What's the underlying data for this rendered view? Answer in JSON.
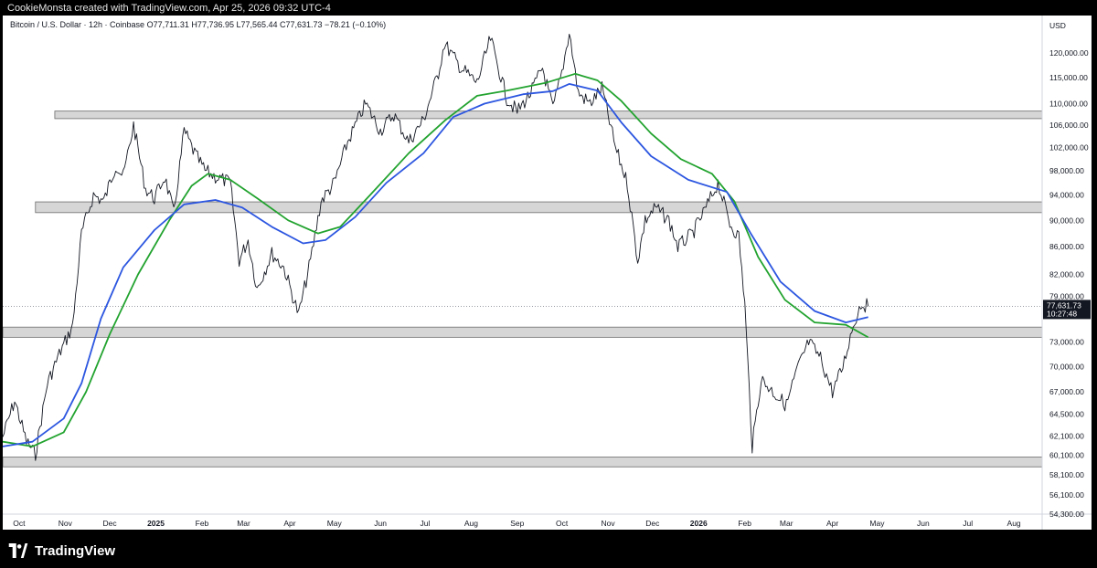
{
  "header": {
    "text": "CookieMonsta created with TradingView.com, Apr 25, 2026 09:32 UTC-4"
  },
  "footer": {
    "brand": "TradingView"
  },
  "chart_data": {
    "type": "line",
    "symbol_line": "Bitcoin / U.S. Dollar · 12h · Coinbase  O77,711.31  H77,736.95  L77,565.44  C77,631.73  −78.21 (−0.10%)",
    "currency": "USD",
    "y_scale": "log",
    "ylim": [
      54300,
      128000
    ],
    "y_ticks": [
      "120,000.00",
      "115,000.00",
      "110,000.00",
      "106,000.00",
      "102,000.00",
      "98,000.00",
      "94,000.00",
      "90,000.00",
      "86,000.00",
      "82,000.00",
      "79,000.00",
      "73,000.00",
      "70,000.00",
      "67,000.00",
      "64,500.00",
      "62,100.00",
      "60,100.00",
      "58,100.00",
      "56,100.00",
      "54,300.00"
    ],
    "x_ticks": [
      {
        "label": "Oct",
        "date": "2024-10-01"
      },
      {
        "label": "Nov",
        "date": "2024-11-01"
      },
      {
        "label": "Dec",
        "date": "2024-12-01"
      },
      {
        "label": "2025",
        "date": "2025-01-01"
      },
      {
        "label": "Feb",
        "date": "2025-02-01"
      },
      {
        "label": "Mar",
        "date": "2025-03-01"
      },
      {
        "label": "Apr",
        "date": "2025-04-01"
      },
      {
        "label": "May",
        "date": "2025-05-01"
      },
      {
        "label": "Jun",
        "date": "2025-06-01"
      },
      {
        "label": "Jul",
        "date": "2025-07-01"
      },
      {
        "label": "Aug",
        "date": "2025-08-01"
      },
      {
        "label": "Sep",
        "date": "2025-09-01"
      },
      {
        "label": "Oct",
        "date": "2025-10-01"
      },
      {
        "label": "Nov",
        "date": "2025-11-01"
      },
      {
        "label": "Dec",
        "date": "2025-12-01"
      },
      {
        "label": "2026",
        "date": "2026-01-01"
      },
      {
        "label": "Feb",
        "date": "2026-02-01"
      },
      {
        "label": "Mar",
        "date": "2026-03-01"
      },
      {
        "label": "Apr",
        "date": "2026-04-01"
      },
      {
        "label": "May",
        "date": "2026-05-01"
      },
      {
        "label": "Jun",
        "date": "2026-06-01"
      },
      {
        "label": "Jul",
        "date": "2026-07-01"
      },
      {
        "label": "Aug",
        "date": "2026-08-01"
      }
    ],
    "xlim": [
      "2024-09-20",
      "2026-08-20"
    ],
    "last_price": {
      "label": "77,631.73",
      "value": 77631.73,
      "countdown": "10:27:48",
      "color": "#131722"
    },
    "zones": [
      {
        "name": "resistance-zone-108k",
        "low": 107200,
        "high": 108600,
        "date_start": "2024-10-25"
      },
      {
        "name": "resistance-zone-92k",
        "low": 91200,
        "high": 92900,
        "date_start": "2024-10-12"
      },
      {
        "name": "support-zone-74k",
        "low": 73600,
        "high": 74900,
        "date_start": "2024-09-20"
      },
      {
        "name": "support-zone-59k",
        "low": 58900,
        "high": 59900,
        "date_start": "2024-09-20"
      }
    ],
    "series": [
      {
        "color": "#131722",
        "style": "price",
        "points": [
          [
            "2024-09-20",
            62000
          ],
          [
            "2024-09-28",
            66000
          ],
          [
            "2024-10-06",
            61500
          ],
          [
            "2024-10-12",
            60200
          ],
          [
            "2024-10-20",
            68000
          ],
          [
            "2024-10-28",
            71500
          ],
          [
            "2024-11-06",
            75000
          ],
          [
            "2024-11-12",
            88000
          ],
          [
            "2024-11-20",
            94000
          ],
          [
            "2024-11-27",
            93000
          ],
          [
            "2024-12-05",
            99000
          ],
          [
            "2024-12-10",
            97000
          ],
          [
            "2024-12-17",
            106000
          ],
          [
            "2024-12-25",
            95000
          ],
          [
            "2024-12-31",
            93500
          ],
          [
            "2025-01-07",
            97000
          ],
          [
            "2025-01-13",
            91000
          ],
          [
            "2025-01-20",
            105000
          ],
          [
            "2025-01-27",
            101000
          ],
          [
            "2025-02-03",
            98000
          ],
          [
            "2025-02-10",
            97000
          ],
          [
            "2025-02-20",
            96000
          ],
          [
            "2025-02-26",
            84000
          ],
          [
            "2025-03-04",
            87000
          ],
          [
            "2025-03-10",
            80000
          ],
          [
            "2025-03-20",
            85000
          ],
          [
            "2025-03-28",
            83000
          ],
          [
            "2025-04-07",
            76500
          ],
          [
            "2025-04-15",
            84000
          ],
          [
            "2025-04-22",
            93000
          ],
          [
            "2025-05-01",
            96000
          ],
          [
            "2025-05-10",
            103000
          ],
          [
            "2025-05-22",
            110000
          ],
          [
            "2025-06-01",
            105000
          ],
          [
            "2025-06-10",
            108000
          ],
          [
            "2025-06-20",
            103000
          ],
          [
            "2025-06-30",
            107000
          ],
          [
            "2025-07-10",
            116000
          ],
          [
            "2025-07-14",
            122000
          ],
          [
            "2025-07-25",
            117000
          ],
          [
            "2025-08-05",
            114000
          ],
          [
            "2025-08-14",
            123000
          ],
          [
            "2025-08-25",
            111000
          ],
          [
            "2025-09-01",
            108500
          ],
          [
            "2025-09-10",
            112000
          ],
          [
            "2025-09-18",
            117000
          ],
          [
            "2025-09-25",
            109000
          ],
          [
            "2025-10-01",
            116000
          ],
          [
            "2025-10-06",
            124500
          ],
          [
            "2025-10-12",
            112000
          ],
          [
            "2025-10-20",
            110000
          ],
          [
            "2025-10-28",
            113000
          ],
          [
            "2025-11-06",
            102000
          ],
          [
            "2025-11-14",
            96000
          ],
          [
            "2025-11-21",
            84000
          ],
          [
            "2025-11-26",
            90000
          ],
          [
            "2025-12-03",
            92000
          ],
          [
            "2025-12-12",
            90000
          ],
          [
            "2025-12-18",
            86000
          ],
          [
            "2025-12-28",
            88000
          ],
          [
            "2026-01-05",
            91500
          ],
          [
            "2026-01-14",
            96000
          ],
          [
            "2026-01-22",
            89500
          ],
          [
            "2026-01-28",
            87500
          ],
          [
            "2026-02-01",
            78000
          ],
          [
            "2026-02-06",
            61000
          ],
          [
            "2026-02-12",
            68500
          ],
          [
            "2026-02-20",
            67000
          ],
          [
            "2026-03-01",
            65500
          ],
          [
            "2026-03-08",
            69500
          ],
          [
            "2026-03-16",
            73000
          ],
          [
            "2026-03-24",
            71000
          ],
          [
            "2026-04-01",
            67000
          ],
          [
            "2026-04-08",
            70000
          ],
          [
            "2026-04-14",
            74500
          ],
          [
            "2026-04-20",
            78000
          ],
          [
            "2026-04-25",
            77631.73
          ]
        ]
      },
      {
        "color": "#22a32f",
        "style": "ma",
        "points": [
          [
            "2024-09-20",
            61500
          ],
          [
            "2024-10-10",
            61000
          ],
          [
            "2024-10-31",
            62500
          ],
          [
            "2024-11-15",
            67000
          ],
          [
            "2024-12-01",
            74000
          ],
          [
            "2024-12-20",
            82000
          ],
          [
            "2025-01-10",
            90000
          ],
          [
            "2025-01-25",
            95500
          ],
          [
            "2025-02-05",
            97500
          ],
          [
            "2025-02-20",
            96500
          ],
          [
            "2025-03-10",
            93500
          ],
          [
            "2025-03-31",
            90000
          ],
          [
            "2025-04-20",
            88000
          ],
          [
            "2025-05-05",
            89000
          ],
          [
            "2025-05-25",
            94000
          ],
          [
            "2025-06-20",
            101000
          ],
          [
            "2025-07-15",
            107000
          ],
          [
            "2025-08-05",
            111500
          ],
          [
            "2025-08-25",
            112500
          ],
          [
            "2025-09-20",
            114000
          ],
          [
            "2025-10-10",
            115800
          ],
          [
            "2025-10-25",
            114500
          ],
          [
            "2025-11-10",
            110500
          ],
          [
            "2025-11-30",
            104500
          ],
          [
            "2025-12-20",
            100000
          ],
          [
            "2026-01-10",
            97500
          ],
          [
            "2026-01-25",
            93000
          ],
          [
            "2026-02-10",
            84500
          ],
          [
            "2026-02-28",
            78500
          ],
          [
            "2026-03-20",
            75500
          ],
          [
            "2026-04-10",
            75200
          ],
          [
            "2026-04-25",
            73600
          ]
        ]
      },
      {
        "color": "#2c56e0",
        "style": "ma",
        "points": [
          [
            "2024-09-20",
            61000
          ],
          [
            "2024-10-10",
            61500
          ],
          [
            "2024-10-31",
            64000
          ],
          [
            "2024-11-12",
            68000
          ],
          [
            "2024-11-25",
            76000
          ],
          [
            "2024-12-10",
            83000
          ],
          [
            "2024-12-31",
            88500
          ],
          [
            "2025-01-20",
            92500
          ],
          [
            "2025-02-10",
            93200
          ],
          [
            "2025-02-28",
            92000
          ],
          [
            "2025-03-20",
            89000
          ],
          [
            "2025-04-10",
            86500
          ],
          [
            "2025-04-25",
            87000
          ],
          [
            "2025-05-15",
            90500
          ],
          [
            "2025-06-05",
            96000
          ],
          [
            "2025-06-30",
            101000
          ],
          [
            "2025-07-20",
            107500
          ],
          [
            "2025-08-10",
            110000
          ],
          [
            "2025-09-05",
            111800
          ],
          [
            "2025-09-25",
            112400
          ],
          [
            "2025-10-06",
            113800
          ],
          [
            "2025-10-25",
            112500
          ],
          [
            "2025-11-10",
            106500
          ],
          [
            "2025-11-30",
            100500
          ],
          [
            "2025-12-25",
            96500
          ],
          [
            "2026-01-20",
            94500
          ],
          [
            "2026-02-05",
            88000
          ],
          [
            "2026-02-25",
            81000
          ],
          [
            "2026-03-20",
            77000
          ],
          [
            "2026-04-10",
            75500
          ],
          [
            "2026-04-25",
            76200
          ]
        ]
      }
    ]
  }
}
